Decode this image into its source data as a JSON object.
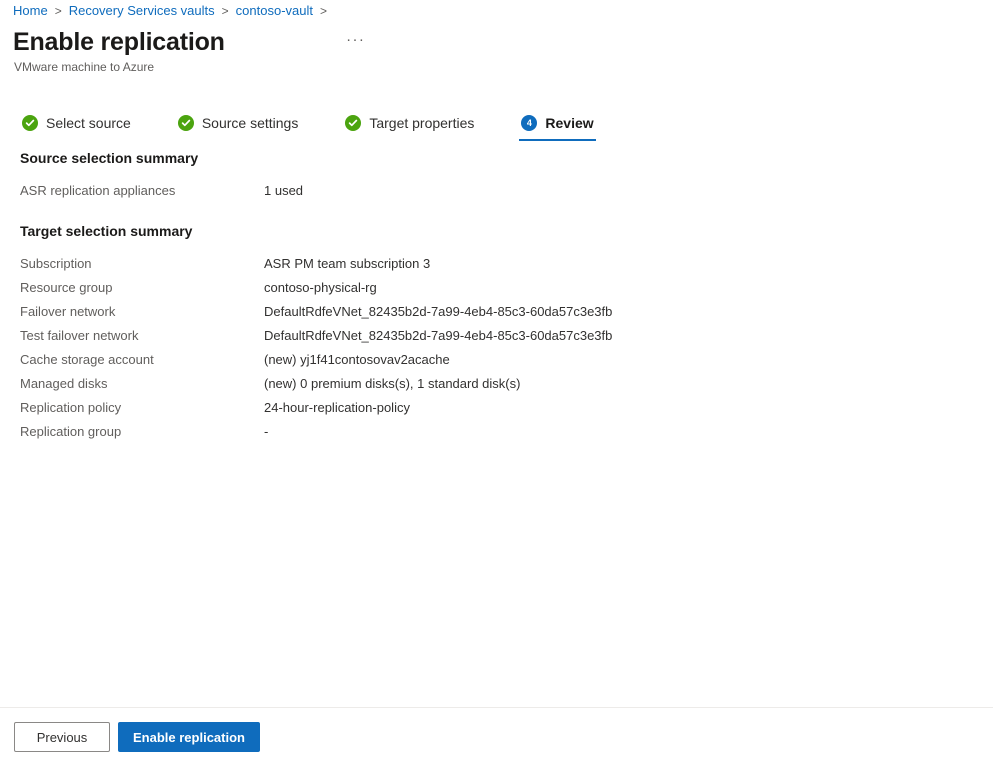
{
  "breadcrumb": {
    "separator": ">",
    "items": [
      {
        "label": "Home"
      },
      {
        "label": "Recovery Services vaults"
      },
      {
        "label": "contoso-vault"
      }
    ]
  },
  "header": {
    "title": "Enable replication",
    "subtitle": "VMware machine to Azure",
    "more_menu": "···",
    "more_menu_icon": "ellipsis-icon"
  },
  "wizard": {
    "tabs": [
      {
        "label": "Select source",
        "state": "done",
        "icon": "check-circle-icon"
      },
      {
        "label": "Source settings",
        "state": "done",
        "icon": "check-circle-icon"
      },
      {
        "label": "Target properties",
        "state": "done",
        "icon": "check-circle-icon"
      },
      {
        "label": "Review",
        "state": "active",
        "number": "4",
        "icon": "step-number-icon"
      }
    ]
  },
  "source_summary": {
    "heading": "Source selection summary",
    "rows": [
      {
        "label": "ASR replication appliances",
        "value": "1 used"
      }
    ]
  },
  "target_summary": {
    "heading": "Target selection summary",
    "rows": [
      {
        "label": "Subscription",
        "value": "ASR PM team subscription 3"
      },
      {
        "label": "Resource group",
        "value": "contoso-physical-rg"
      },
      {
        "label": "Failover network",
        "value": "DefaultRdfeVNet_82435b2d-7a99-4eb4-85c3-60da57c3e3fb"
      },
      {
        "label": "Test failover network",
        "value": "DefaultRdfeVNet_82435b2d-7a99-4eb4-85c3-60da57c3e3fb"
      },
      {
        "label": "Cache storage account",
        "value": "(new) yj1f41contosovav2acache"
      },
      {
        "label": "Managed disks",
        "value": "(new) 0 premium disks(s), 1 standard disk(s)"
      },
      {
        "label": "Replication policy",
        "value": "24-hour-replication-policy"
      },
      {
        "label": "Replication group",
        "value": "-"
      }
    ]
  },
  "footer": {
    "previous_label": "Previous",
    "submit_label": "Enable replication"
  },
  "colors": {
    "link": "#0f6cbd",
    "accent": "#0f6cbd",
    "success": "#4ba40f",
    "text_primary": "#323130",
    "text_secondary": "#605e5c"
  }
}
